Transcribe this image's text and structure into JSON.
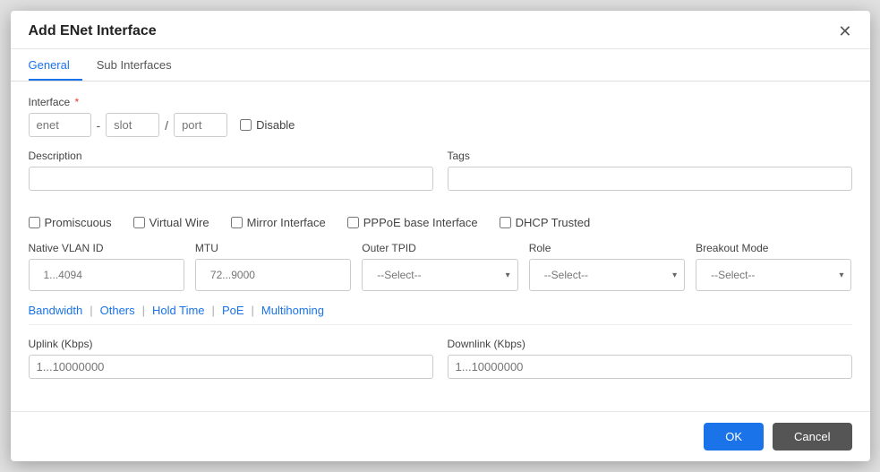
{
  "dialog": {
    "title": "Add ENet Interface",
    "close_label": "✕"
  },
  "tabs": [
    {
      "id": "general",
      "label": "General",
      "active": true
    },
    {
      "id": "sub-interfaces",
      "label": "Sub Interfaces",
      "active": false
    }
  ],
  "interface_section": {
    "label": "Interface",
    "enet_placeholder": "enet",
    "slot_placeholder": "slot",
    "port_placeholder": "port",
    "disable_label": "Disable"
  },
  "description_section": {
    "label": "Description",
    "placeholder": ""
  },
  "tags_section": {
    "label": "Tags",
    "placeholder": ""
  },
  "checkboxes": [
    {
      "id": "promiscuous",
      "label": "Promiscuous"
    },
    {
      "id": "virtual-wire",
      "label": "Virtual Wire"
    },
    {
      "id": "mirror-interface",
      "label": "Mirror Interface"
    },
    {
      "id": "pppoe-base",
      "label": "PPPoE base Interface"
    },
    {
      "id": "dhcp-trusted",
      "label": "DHCP Trusted"
    }
  ],
  "dropdowns": [
    {
      "id": "native-vlan-id",
      "label": "Native VLAN ID",
      "placeholder": "1...4094",
      "type": "number"
    },
    {
      "id": "mtu",
      "label": "MTU",
      "placeholder": "72...9000",
      "type": "number"
    },
    {
      "id": "outer-tpid",
      "label": "Outer TPID",
      "placeholder": "--Select--",
      "type": "select"
    },
    {
      "id": "role",
      "label": "Role",
      "placeholder": "--Select--",
      "type": "select"
    },
    {
      "id": "breakout-mode",
      "label": "Breakout Mode",
      "placeholder": "--Select--",
      "type": "select"
    }
  ],
  "links": [
    {
      "id": "bandwidth",
      "label": "Bandwidth"
    },
    {
      "id": "others",
      "label": "Others"
    },
    {
      "id": "hold-time",
      "label": "Hold Time"
    },
    {
      "id": "poe",
      "label": "PoE"
    },
    {
      "id": "multihoming",
      "label": "Multihoming"
    }
  ],
  "bandwidth": {
    "uplink_label": "Uplink (Kbps)",
    "uplink_placeholder": "1...10000000",
    "downlink_label": "Downlink (Kbps)",
    "downlink_placeholder": "1...10000000"
  },
  "footer": {
    "ok_label": "OK",
    "cancel_label": "Cancel"
  }
}
